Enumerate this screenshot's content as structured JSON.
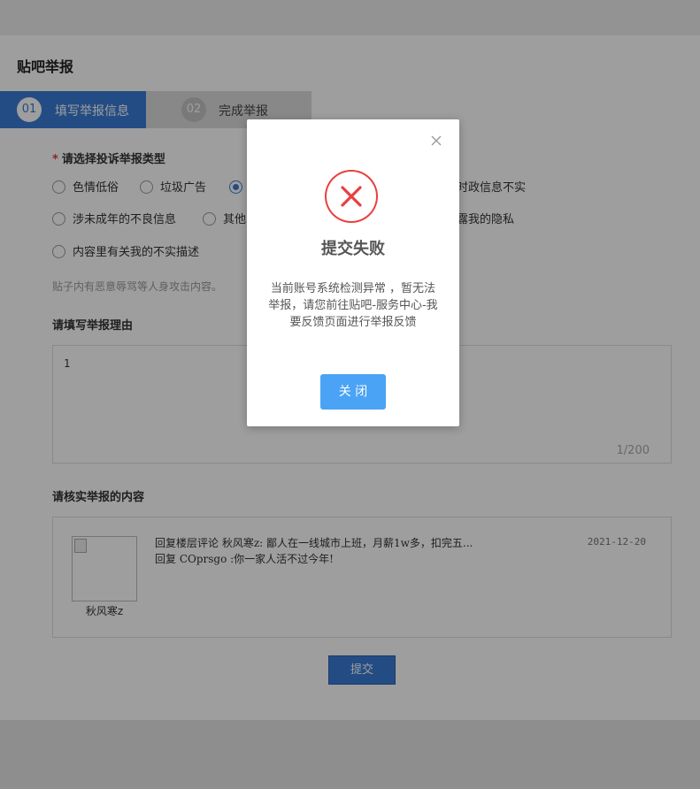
{
  "page": {
    "title": "贴吧举报",
    "steps": [
      {
        "num": "01",
        "label": "填写举报信息"
      },
      {
        "num": "02",
        "label": "完成举报"
      }
    ],
    "type_section": {
      "label": "请选择投诉举报类型",
      "options": [
        {
          "label": "色情低俗",
          "selected": false
        },
        {
          "label": "垃圾广告",
          "selected": false
        },
        {
          "label": "",
          "selected": true
        },
        {
          "label": "时政信息不实",
          "selected": false
        },
        {
          "label": "涉未成年的不良信息",
          "selected": false
        },
        {
          "label": "其他",
          "selected": false
        },
        {
          "label": "露我的隐私",
          "selected": false
        },
        {
          "label": "内容里有关我的不实描述",
          "selected": false
        }
      ],
      "hint": "贴子内有恶意辱骂等人身攻击内容。"
    },
    "reason_section": {
      "label": "请填写举报理由",
      "value": "1",
      "counter": "1/200"
    },
    "content_section": {
      "label": "请核实举报的内容",
      "username": "秋风寒z",
      "reply_line1": "回复楼层评论 秋风寒z: 鄙人在一线城市上班，月薪1w多，扣完五...",
      "reply_line2": "回复 COprsgo :你一家人活不过今年!",
      "date": "2021-12-20"
    },
    "submit_label": "提交"
  },
  "modal": {
    "title": "提交失败",
    "message": "当前账号系统检测异常 ，暂无法举报，请您前往贴吧-服务中心-我要反馈页面进行举报反馈",
    "button_label": "关 闭",
    "icons": {
      "close": "close-icon",
      "error": "error-x-circle-icon"
    },
    "colors": {
      "error": "#e84040",
      "button": "#4aa3f5",
      "step_active": "#3a7bd5"
    }
  }
}
